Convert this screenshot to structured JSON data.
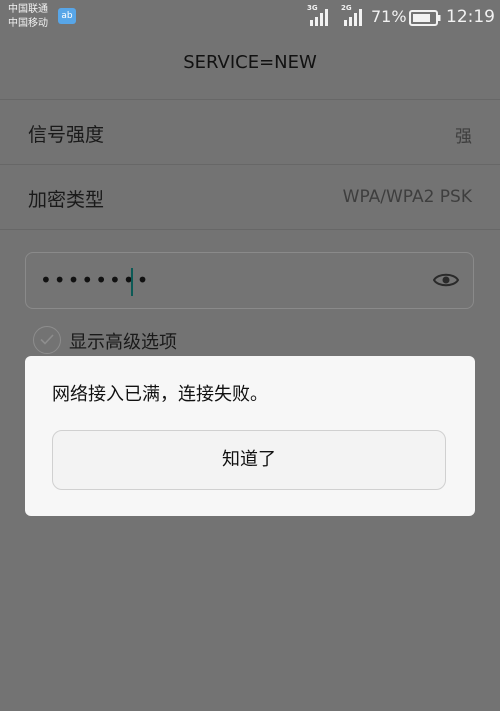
{
  "status_bar": {
    "carrier_1": "中国联通",
    "carrier_2": "中国移动",
    "app_badge": "ab",
    "signal_1_tag": "3G",
    "signal_2_tag": "2G",
    "battery_percent": "71%",
    "time": "12:19"
  },
  "header": {
    "title": "SERVICE=NEW"
  },
  "details": [
    {
      "label": "信号强度",
      "value": "强"
    },
    {
      "label": "加密类型",
      "value": "WPA/WPA2 PSK"
    }
  ],
  "password": {
    "masked_value": "••••••••",
    "toggle_icon": "eye-icon"
  },
  "advanced": {
    "label": "显示高级选项",
    "checked": false
  },
  "dialog": {
    "message": "网络接入已满，连接失败。",
    "button_label": "知道了"
  },
  "colors": {
    "overlay": "#737373",
    "dialog_bg": "#f7f7f7",
    "cursor": "#0c5a56"
  }
}
